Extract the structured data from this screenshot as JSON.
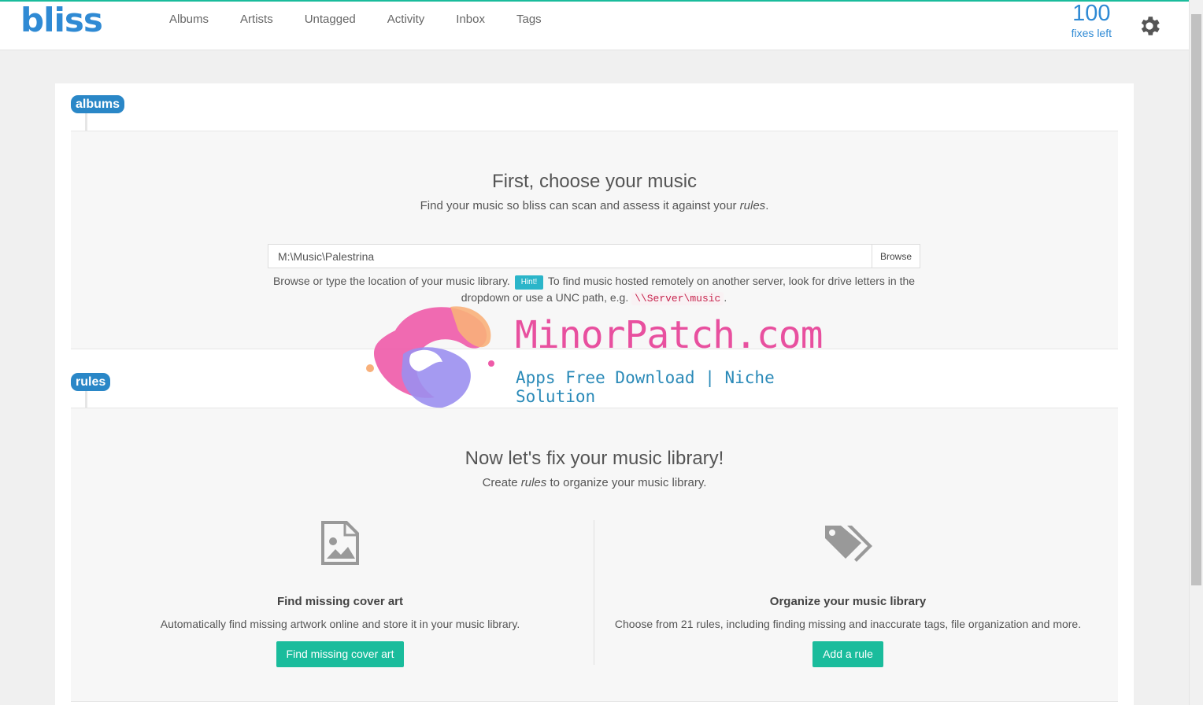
{
  "app": {
    "logo": "bliss"
  },
  "nav": [
    "Albums",
    "Artists",
    "Untagged",
    "Activity",
    "Inbox",
    "Tags"
  ],
  "fixes": {
    "count": "100",
    "label": "fixes left"
  },
  "albums": {
    "pill": "albums",
    "title": "First, choose your music",
    "subtitle_pre": "Find your music so bliss can scan and assess it against your ",
    "subtitle_em": "rules",
    "subtitle_post": ".",
    "path_value": "M:\\Music\\Palestrina",
    "browse_label": "Browse",
    "hint_pre": "Browse or type the location of your music library.",
    "hint_badge": "Hint!",
    "hint_post": "To find music hosted remotely on another server, look for drive letters in the dropdown or use a UNC path, e.g.",
    "hint_code": "\\\\Server\\music",
    "hint_end": "."
  },
  "rules": {
    "pill": "rules",
    "title": "Now let's fix your music library!",
    "subtitle_pre": "Create ",
    "subtitle_em": "rules",
    "subtitle_post": " to organize your music library.",
    "cards": [
      {
        "icon": "image-file-icon",
        "title": "Find missing cover art",
        "desc": "Automatically find missing artwork online and store it in your music library.",
        "button": "Find missing cover art"
      },
      {
        "icon": "tags-icon",
        "title": "Organize your music library",
        "desc": "Choose from 21 rules, including finding missing and inaccurate tags, file organization and more.",
        "button": "Add a rule"
      }
    ]
  },
  "watermark": {
    "title": "MinorPatch.com",
    "tagline": "Apps Free Download | Niche Solution"
  },
  "colors": {
    "brand": "#2f8ad4",
    "accent": "#1abc9c",
    "pill": "#2a87c7",
    "hint": "#2bb5c9"
  }
}
